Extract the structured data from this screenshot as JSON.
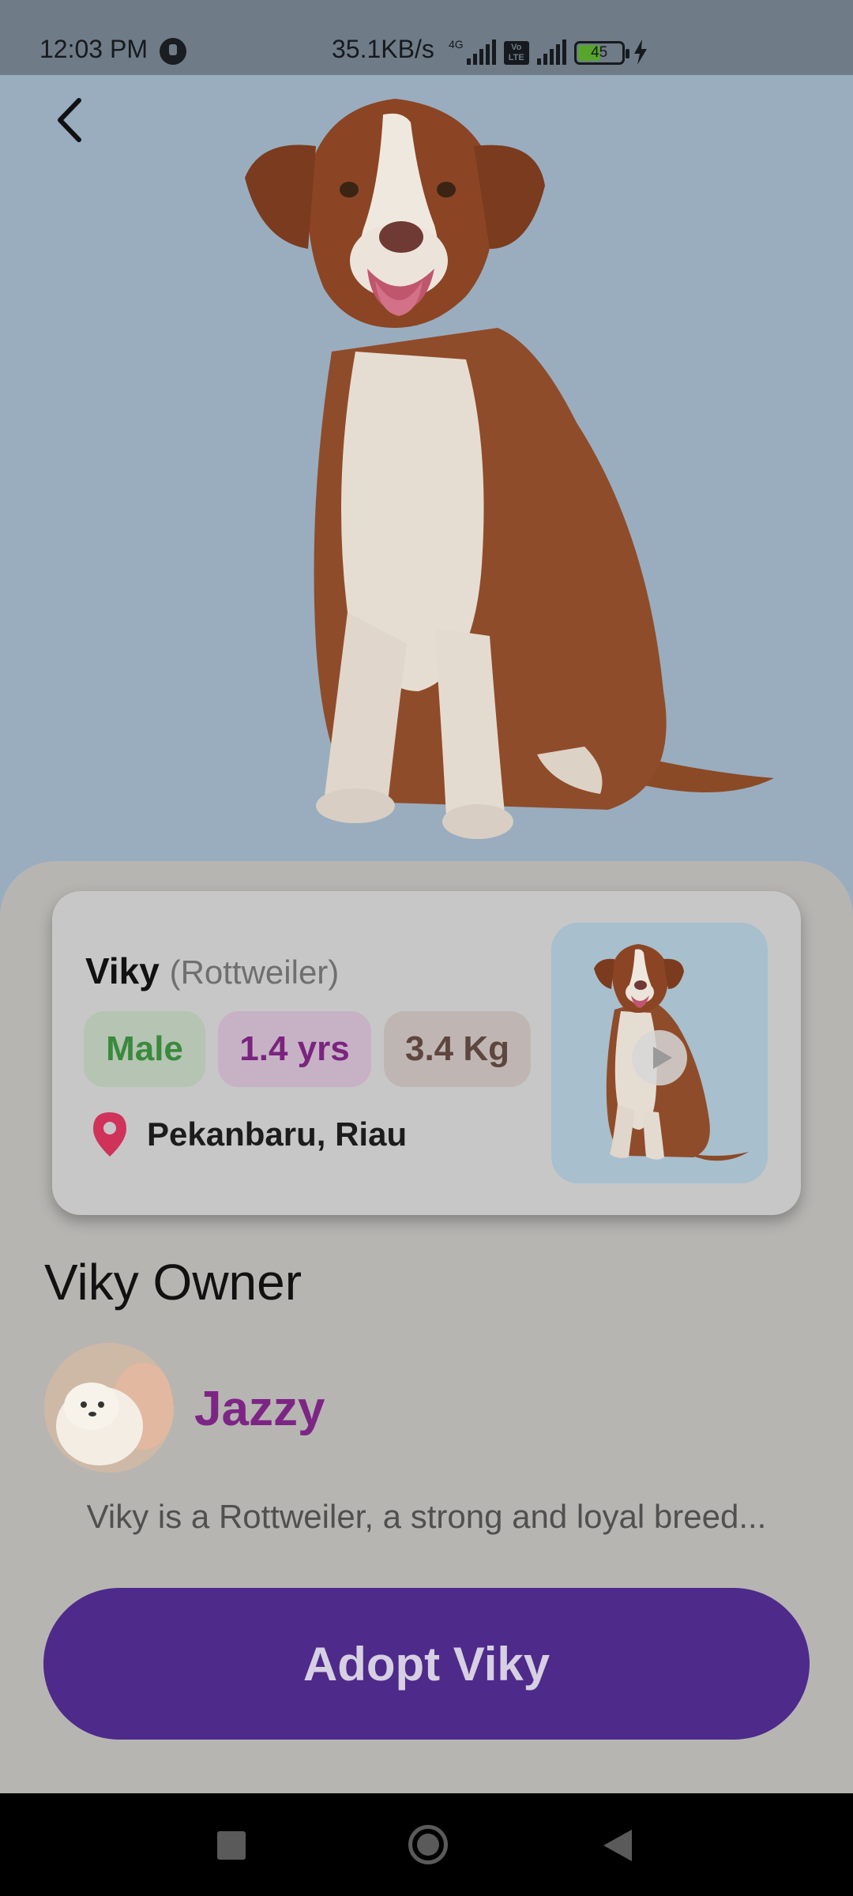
{
  "status_bar": {
    "time": "12:03 PM",
    "net_speed": "35.1KB/s",
    "network": "4G",
    "volte": "Vo\nLTE",
    "battery": "45"
  },
  "pet": {
    "name": "Viky",
    "breed": "(Rottweiler)",
    "gender": "Male",
    "age": "1.4 yrs",
    "weight": "3.4 Kg",
    "location": "Pekanbaru, Riau"
  },
  "owner": {
    "section_title": "Viky Owner",
    "name": "Jazzy"
  },
  "description": "Viky is a Rottweiler, a strong and loyal breed...",
  "actions": {
    "adopt_label": "Adopt Viky"
  },
  "colors": {
    "hero_bg": "#99adbf",
    "sheet_bg": "#b7b5b2",
    "accent_purple": "#4e2a8b",
    "owner_name": "#7d2585",
    "location_pin": "#d0335a"
  },
  "icons": {
    "back": "back-arrow-icon",
    "location": "location-pin-icon",
    "play": "play-icon"
  }
}
